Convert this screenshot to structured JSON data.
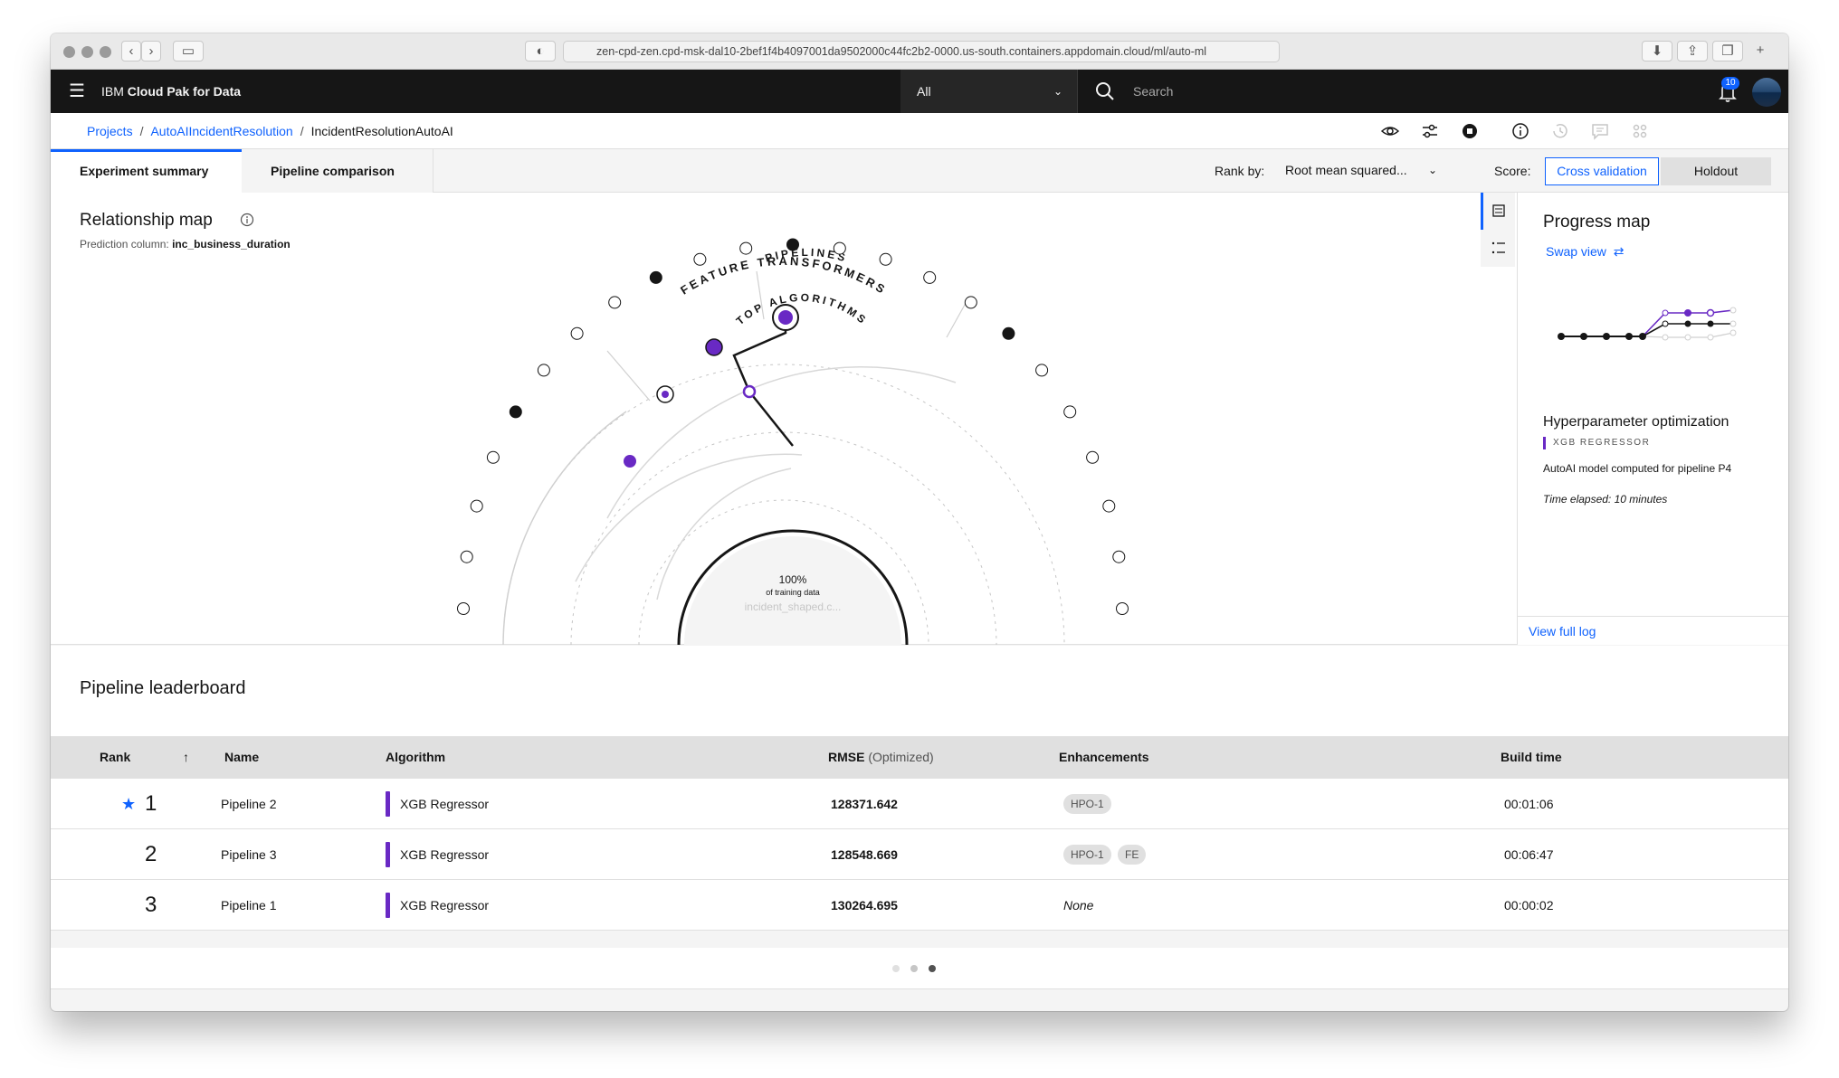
{
  "browser": {
    "url": "zen-cpd-zen.cpd-msk-dal10-2bef1f4b4097001da9502000c44fc2b2-0000.us-south.containers.appdomain.cloud/ml/auto-ml"
  },
  "topnav": {
    "brand_prefix": "IBM",
    "brand_name": "Cloud Pak for Data",
    "scope": "All",
    "search_placeholder": "Search",
    "notifications": "10"
  },
  "breadcrumb": {
    "items": [
      "Projects",
      "AutoAIIncidentResolution",
      "IncidentResolutionAutoAI"
    ]
  },
  "tabs": {
    "summary": "Experiment summary",
    "comparison": "Pipeline comparison"
  },
  "controls": {
    "rank_by_label": "Rank by:",
    "rank_by_value": "Root mean squared...",
    "score_label": "Score:",
    "score_options": [
      "Cross validation",
      "Holdout"
    ],
    "score_selected": "Cross validation"
  },
  "relationship_map": {
    "title": "Relationship map",
    "prediction_label": "Prediction column:",
    "prediction_value": "inc_business_duration",
    "ring_feature": "FEATURE TRANSFORMERS",
    "ring_pipelines": "PIPELINES",
    "ring_algorithms": "TOP ALGORITHMS",
    "center_percent": "100%",
    "center_caption": "of training data",
    "center_file": "incident_shaped.c..."
  },
  "progress_map": {
    "title": "Progress map",
    "swap_view": "Swap view",
    "stage_title": "Hyperparameter optimization",
    "stage_algorithm": "XGB REGRESSOR",
    "stage_desc": "AutoAI model computed for pipeline P4",
    "time_elapsed": "Time elapsed: 10 minutes",
    "view_log": "View full log"
  },
  "leaderboard": {
    "title": "Pipeline leaderboard",
    "headers": {
      "rank": "Rank",
      "name": "Name",
      "algorithm": "Algorithm",
      "metric": "RMSE",
      "metric_note": "(Optimized)",
      "enhancements": "Enhancements",
      "build_time": "Build time"
    },
    "rows": [
      {
        "rank": "1",
        "name": "Pipeline 2",
        "algorithm": "XGB Regressor",
        "rmse": "128371.642",
        "enh": [
          "HPO-1"
        ],
        "build_time": "00:01:06"
      },
      {
        "rank": "2",
        "name": "Pipeline 3",
        "algorithm": "XGB Regressor",
        "rmse": "128548.669",
        "enh": [
          "HPO-1",
          "FE"
        ],
        "build_time": "00:06:47"
      },
      {
        "rank": "3",
        "name": "Pipeline 1",
        "algorithm": "XGB Regressor",
        "rmse": "130264.695",
        "enh_none": "None",
        "build_time": "00:00:02"
      }
    ],
    "pages": 3,
    "current_page": 3
  },
  "colors": {
    "accent": "#0f62fe",
    "algorithm": "#6929c4",
    "header_bg": "#161616"
  }
}
